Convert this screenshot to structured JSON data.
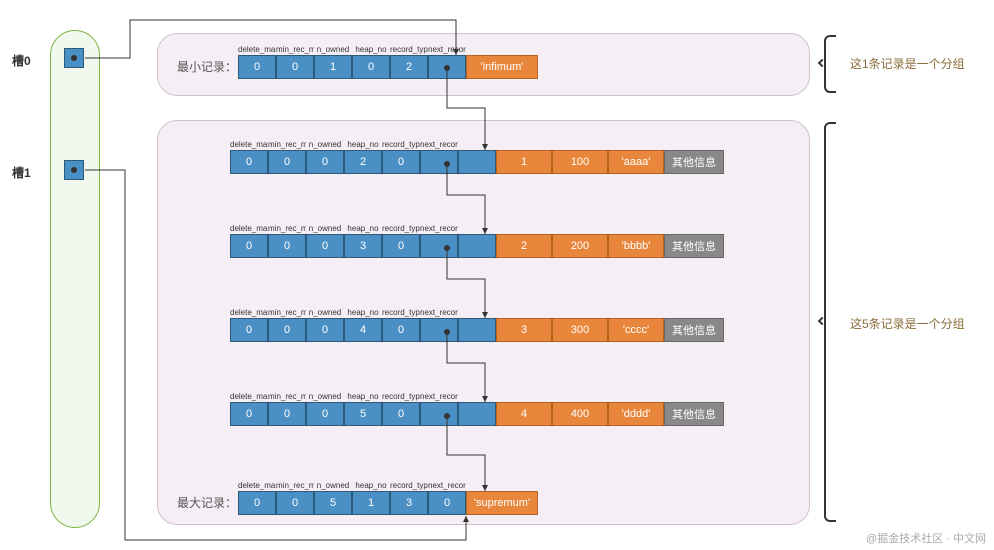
{
  "slots": {
    "slot0_label": "槽0",
    "slot1_label": "槽1"
  },
  "group1": {
    "label": "这1条记录是一个分组"
  },
  "group2": {
    "label": "这5条记录是一个分组"
  },
  "min_record": {
    "label": "最小记录：",
    "tag": "'infimum'"
  },
  "max_record": {
    "label": "最大记录：",
    "tag": "'supremum'"
  },
  "headers": {
    "delete_mask": "delete_mask",
    "min_rec_mask": "min_rec_mask",
    "n_owned": "n_owned",
    "heap_no": "heap_no",
    "record_type": "record_type",
    "next_record": "next_record"
  },
  "other_info": "其他信息",
  "records": [
    {
      "h": [
        0,
        0,
        1,
        0,
        2,
        "→"
      ],
      "id": null,
      "val": null,
      "key": null,
      "type": "min"
    },
    {
      "h": [
        0,
        0,
        0,
        2,
        0,
        "→"
      ],
      "id": 1,
      "val": 100,
      "key": "'aaaa'",
      "type": "data"
    },
    {
      "h": [
        0,
        0,
        0,
        3,
        0,
        "→"
      ],
      "id": 2,
      "val": 200,
      "key": "'bbbb'",
      "type": "data"
    },
    {
      "h": [
        0,
        0,
        0,
        4,
        0,
        "→"
      ],
      "id": 3,
      "val": 300,
      "key": "'cccc'",
      "type": "data"
    },
    {
      "h": [
        0,
        0,
        0,
        5,
        0,
        "→"
      ],
      "id": 4,
      "val": 400,
      "key": "'dddd'",
      "type": "data"
    },
    {
      "h": [
        0,
        0,
        5,
        1,
        3,
        0
      ],
      "id": null,
      "val": null,
      "key": null,
      "type": "max"
    }
  ],
  "watermark": "@掘金技术社区 · 中文网"
}
